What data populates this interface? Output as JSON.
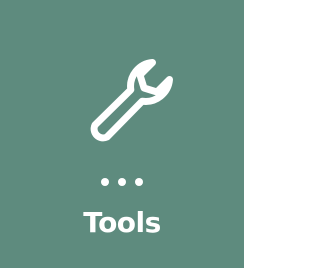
{
  "tile": {
    "label": "Tools",
    "icon": "wrench-icon",
    "more_icon": "ellipsis-icon",
    "background_color": "#5e8b7e",
    "foreground_color": "#ffffff"
  }
}
